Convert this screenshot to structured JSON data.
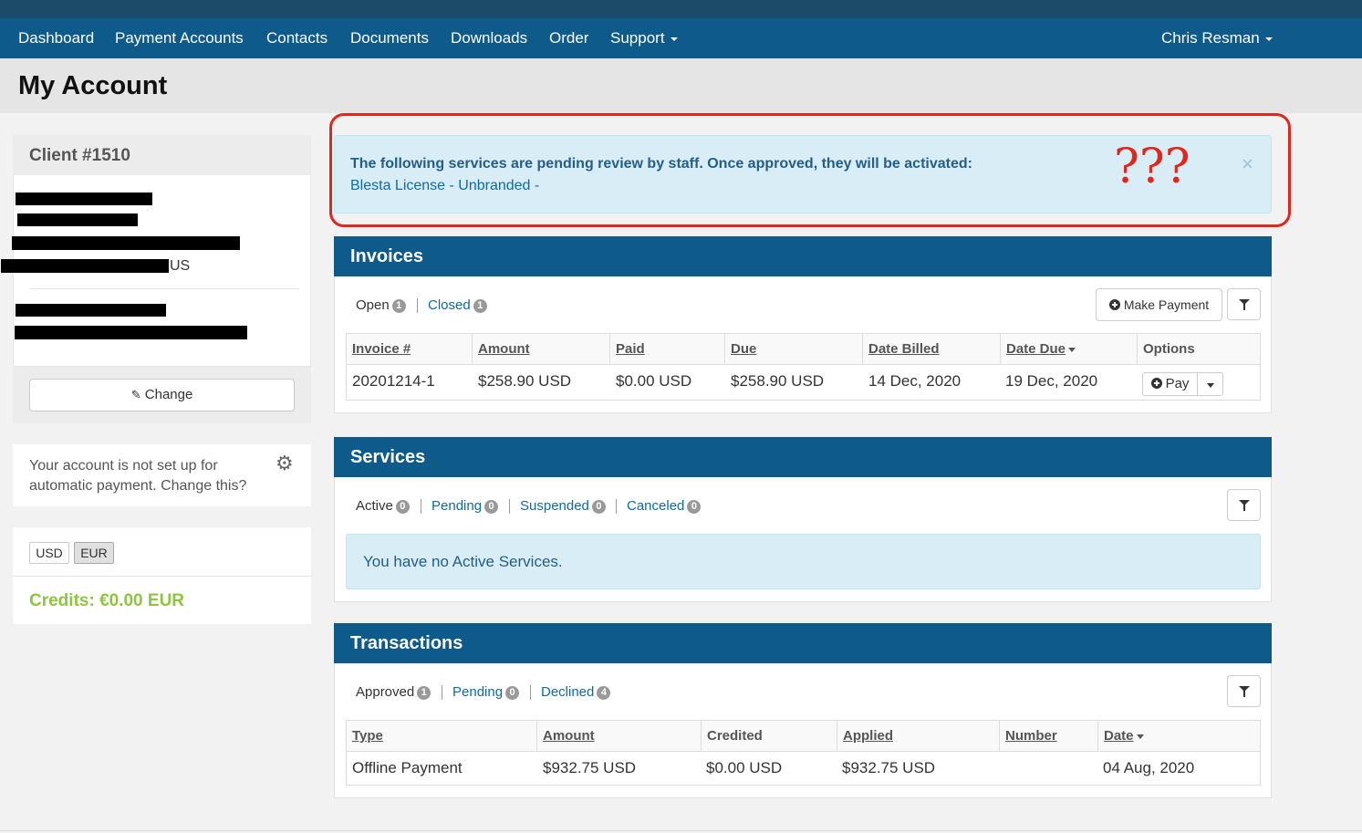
{
  "nav": {
    "items": [
      "Dashboard",
      "Payment Accounts",
      "Contacts",
      "Documents",
      "Downloads",
      "Order",
      "Support"
    ],
    "user": "Chris Resman"
  },
  "page_title": "My Account",
  "client": {
    "title": "Client #1510",
    "country_suffix": "US",
    "change_label": "Change"
  },
  "autopay": {
    "text": "Your account is not set up for automatic payment. Change this?"
  },
  "currency": {
    "options": [
      "USD",
      "EUR"
    ],
    "selected": "EUR",
    "credits": "Credits: €0.00 EUR"
  },
  "alert": {
    "message": "The following services are pending review by staff. Once approved, they will be activated:",
    "service": "Blesta License - Unbranded -",
    "annotation": "???",
    "close": "×"
  },
  "invoices": {
    "title": "Invoices",
    "tabs": [
      {
        "label": "Open",
        "count": "1"
      },
      {
        "label": "Closed",
        "count": "1"
      }
    ],
    "make_payment": "Make Payment",
    "columns": [
      "Invoice #",
      "Amount",
      "Paid",
      "Due",
      "Date Billed",
      "Date Due",
      "Options"
    ],
    "rows": [
      {
        "invoice": "20201214-1",
        "amount": "$258.90 USD",
        "paid": "$0.00 USD",
        "due": "$258.90 USD",
        "billed": "14 Dec, 2020",
        "date_due": "19 Dec, 2020"
      }
    ],
    "pay_label": "Pay"
  },
  "services": {
    "title": "Services",
    "tabs": [
      {
        "label": "Active",
        "count": "0"
      },
      {
        "label": "Pending",
        "count": "0"
      },
      {
        "label": "Suspended",
        "count": "0"
      },
      {
        "label": "Canceled",
        "count": "0"
      }
    ],
    "empty": "You have no Active Services."
  },
  "transactions": {
    "title": "Transactions",
    "tabs": [
      {
        "label": "Approved",
        "count": "1"
      },
      {
        "label": "Pending",
        "count": "0"
      },
      {
        "label": "Declined",
        "count": "4"
      }
    ],
    "columns": [
      "Type",
      "Amount",
      "Credited",
      "Applied",
      "Number",
      "Date"
    ],
    "rows": [
      {
        "type": "Offline Payment",
        "amount": "$932.75 USD",
        "credited": "$0.00 USD",
        "applied": "$932.75 USD",
        "number": "",
        "date": "04 Aug, 2020"
      }
    ]
  },
  "colors": {
    "nav": "#0e5a8a",
    "link": "#0e6aa6",
    "credits": "#8cc63f",
    "alert_bg": "#d9edf7",
    "annotation": "#e1261c"
  }
}
